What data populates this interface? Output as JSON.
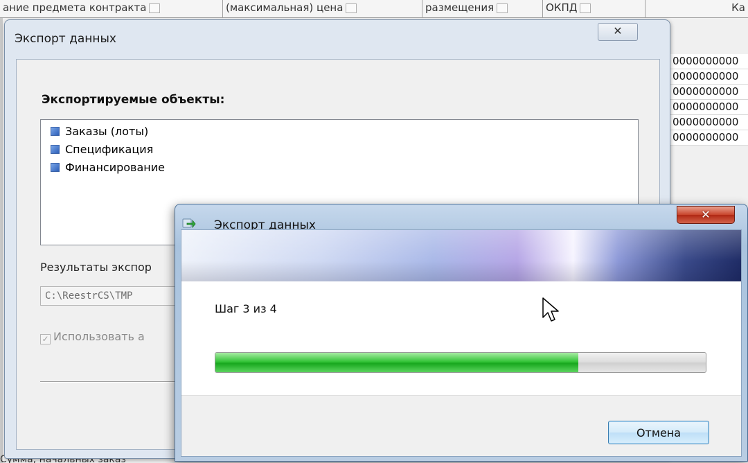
{
  "background": {
    "columns": [
      "ание предмета контракта",
      "(максимальная) цена",
      "размещения",
      "ОКПД",
      "Ка"
    ],
    "rows": [
      "0000000000",
      "0000000000",
      "0000000000",
      "0000000000",
      "0000000000",
      "0000000000"
    ],
    "bottom_text": "Сумма, начальных заказ"
  },
  "main_dialog": {
    "title": "Экспорт данных",
    "close_label": "✕",
    "objects_heading": "Экспортируемые объекты:",
    "objects": [
      "Заказы (лоты)",
      "Спецификация",
      "Финансирование"
    ],
    "results_label": "Результаты экспор",
    "path_value": "C:\\ReestrCS\\TMP",
    "auto_check_label": "Использовать а",
    "auto_check_mark": "✓"
  },
  "progress_dialog": {
    "title": "Экспорт данных",
    "close_label": "✕",
    "step_text": "Шаг 3 из 4",
    "progress_fraction": 0.74,
    "cancel_label": "Отмена"
  },
  "colors": {
    "progress_green": "#22b428",
    "close_red": "#c8442c"
  },
  "icons": {
    "progress_dialog_icon": "export-arrow-icon",
    "cursor": "mouse-pointer-icon"
  }
}
